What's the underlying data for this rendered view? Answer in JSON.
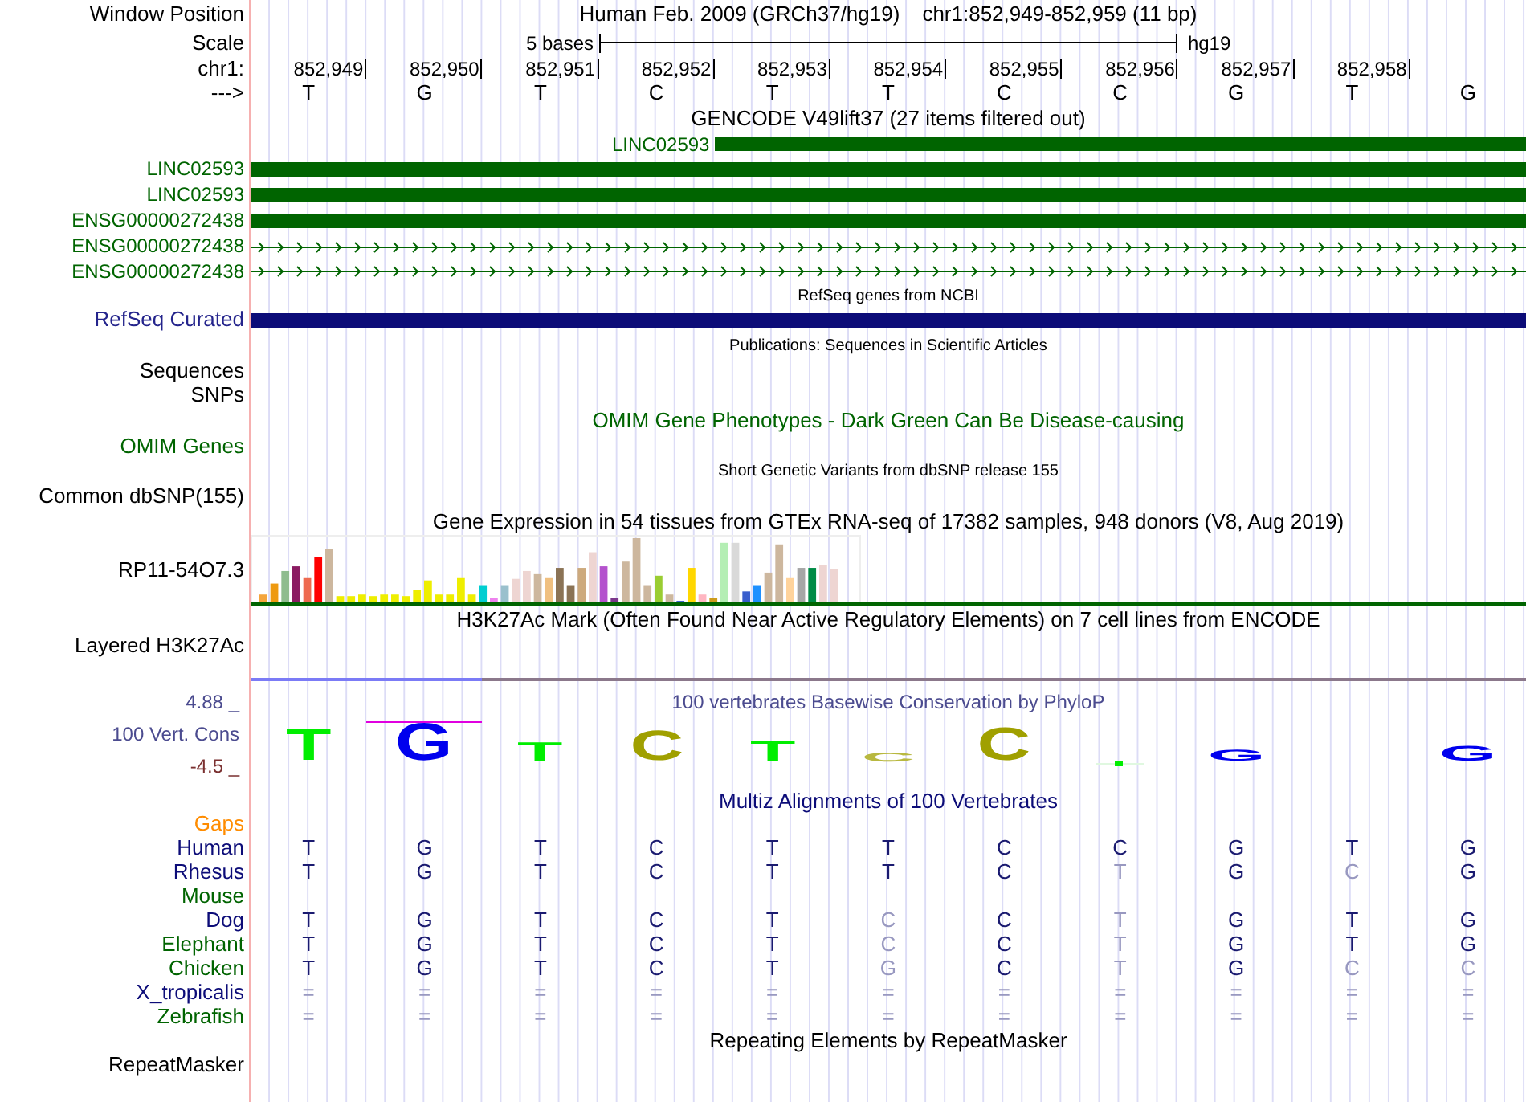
{
  "header": {
    "label": "Window Position",
    "assembly": "Human Feb. 2009 (GRCh37/hg19)",
    "position": "chr1:852,949-852,959 (11 bp)"
  },
  "scale": {
    "label": "Scale",
    "span": "5 bases",
    "assembly": "hg19"
  },
  "ruler": {
    "label": "chr1:",
    "positions": [
      "852,949",
      "852,950",
      "852,951",
      "852,952",
      "852,953",
      "852,954",
      "852,955",
      "852,956",
      "852,957",
      "852,958"
    ]
  },
  "sequence": {
    "label": "--->",
    "bases": [
      "T",
      "G",
      "T",
      "C",
      "T",
      "T",
      "C",
      "C",
      "G",
      "T",
      "G"
    ]
  },
  "gencode": {
    "title": "GENCODE V49lift37 (27 items filtered out)",
    "items": [
      {
        "name": "LINC02593",
        "kind": "partial"
      },
      {
        "name": "LINC02593",
        "kind": "exon"
      },
      {
        "name": "LINC02593",
        "kind": "exon"
      },
      {
        "name": "ENSG00000272438",
        "kind": "exon"
      },
      {
        "name": "ENSG00000272438",
        "kind": "intron"
      },
      {
        "name": "ENSG00000272438",
        "kind": "intron"
      }
    ]
  },
  "refseq": {
    "title": "RefSeq genes from NCBI",
    "label": "RefSeq Curated"
  },
  "publications": {
    "title": "Publications: Sequences in Scientific Articles",
    "labels": [
      "Sequences",
      "SNPs"
    ]
  },
  "omim": {
    "title": "OMIM Gene Phenotypes - Dark Green Can Be Disease-causing",
    "label": "OMIM Genes"
  },
  "dbsnp": {
    "title": "Short Genetic Variants from dbSNP release 155",
    "label": "Common dbSNP(155)"
  },
  "gtex": {
    "title": "Gene Expression in 54 tissues from GTEx RNA-seq of 17382 samples, 948 donors (V8, Aug 2019)",
    "label": "RP11-54O7.3"
  },
  "h3k27ac": {
    "title": "H3K27Ac Mark (Often Found Near Active Regulatory Elements) on 7 cell lines from ENCODE",
    "label": "Layered H3K27Ac"
  },
  "conservation": {
    "title": "100 vertebrates Basewise Conservation by PhyloP",
    "label": "100 Vert. Cons",
    "max": "4.88 _",
    "min": "-4.5 _",
    "logo": [
      {
        "base": "T",
        "color": "#00ee00",
        "marked": false
      },
      {
        "base": "G",
        "color": "#0000ee",
        "marked": true
      },
      {
        "base": "T",
        "color": "#00ee00",
        "marked": false
      },
      {
        "base": "C",
        "color": "#a0a000",
        "marked": false
      },
      {
        "base": "T",
        "color": "#00ee00",
        "marked": false
      },
      {
        "base": "C",
        "color": "#b8b840",
        "marked": false
      },
      {
        "base": "C",
        "color": "#a0a000",
        "marked": false
      },
      {
        "base": "G",
        "color": "#0000ee",
        "marked": false
      },
      {
        "base": "G",
        "color": "#0000ee",
        "marked": false
      }
    ]
  },
  "multiz": {
    "title": "Multiz Alignments of 100 Vertebrates",
    "gaps_label": "Gaps",
    "species": [
      {
        "name": "Human",
        "color": "#0c0c78",
        "bases": [
          {
            "base": "T",
            "faded": false
          },
          {
            "base": "G",
            "faded": false
          },
          {
            "base": "T",
            "faded": false
          },
          {
            "base": "C",
            "faded": false
          },
          {
            "base": "T",
            "faded": false
          },
          {
            "base": "T",
            "faded": false
          },
          {
            "base": "C",
            "faded": false
          },
          {
            "base": "C",
            "faded": false
          },
          {
            "base": "G",
            "faded": false
          },
          {
            "base": "T",
            "faded": false
          },
          {
            "base": "G",
            "faded": false
          }
        ]
      },
      {
        "name": "Rhesus",
        "color": "#0c0c78",
        "bases": [
          {
            "base": "T",
            "faded": false
          },
          {
            "base": "G",
            "faded": false
          },
          {
            "base": "T",
            "faded": false
          },
          {
            "base": "C",
            "faded": false
          },
          {
            "base": "T",
            "faded": false
          },
          {
            "base": "T",
            "faded": false
          },
          {
            "base": "C",
            "faded": false
          },
          {
            "base": "T",
            "faded": true
          },
          {
            "base": "G",
            "faded": false
          },
          {
            "base": "C",
            "faded": true
          },
          {
            "base": "G",
            "faded": false
          }
        ]
      },
      {
        "name": "Mouse",
        "color": "#006400"
      },
      {
        "name": "Dog",
        "color": "#0c0c78",
        "bases": [
          {
            "base": "T",
            "faded": false
          },
          {
            "base": "G",
            "faded": false
          },
          {
            "base": "T",
            "faded": false
          },
          {
            "base": "C",
            "faded": false
          },
          {
            "base": "T",
            "faded": false
          },
          {
            "base": "C",
            "faded": true
          },
          {
            "base": "C",
            "faded": false
          },
          {
            "base": "T",
            "faded": true
          },
          {
            "base": "G",
            "faded": false
          },
          {
            "base": "T",
            "faded": false
          },
          {
            "base": "G",
            "faded": false
          }
        ]
      },
      {
        "name": "Elephant",
        "color": "#006400",
        "bases": [
          {
            "base": "T",
            "faded": false
          },
          {
            "base": "G",
            "faded": false
          },
          {
            "base": "T",
            "faded": false
          },
          {
            "base": "C",
            "faded": false
          },
          {
            "base": "T",
            "faded": false
          },
          {
            "base": "C",
            "faded": true
          },
          {
            "base": "C",
            "faded": false
          },
          {
            "base": "T",
            "faded": true
          },
          {
            "base": "G",
            "faded": false
          },
          {
            "base": "T",
            "faded": false
          },
          {
            "base": "G",
            "faded": false
          }
        ]
      },
      {
        "name": "Chicken",
        "color": "#006400",
        "bases": [
          {
            "base": "T",
            "faded": false
          },
          {
            "base": "G",
            "faded": false
          },
          {
            "base": "T",
            "faded": false
          },
          {
            "base": "C",
            "faded": false
          },
          {
            "base": "T",
            "faded": false
          },
          {
            "base": "G",
            "faded": true
          },
          {
            "base": "C",
            "faded": false
          },
          {
            "base": "T",
            "faded": true
          },
          {
            "base": "G",
            "faded": false
          },
          {
            "base": "C",
            "faded": true
          },
          {
            "base": "C",
            "faded": true
          }
        ]
      },
      {
        "name": "X_tropicalis",
        "color": "#0c0c78",
        "bases": [
          {
            "base": "=",
            "faded": true
          },
          {
            "base": "=",
            "faded": true
          },
          {
            "base": "=",
            "faded": true
          },
          {
            "base": "=",
            "faded": true
          },
          {
            "base": "=",
            "faded": true
          },
          {
            "base": "=",
            "faded": true
          },
          {
            "base": "=",
            "faded": true
          },
          {
            "base": "=",
            "faded": true
          },
          {
            "base": "=",
            "faded": true
          },
          {
            "base": "=",
            "faded": true
          },
          {
            "base": "=",
            "faded": true
          }
        ]
      },
      {
        "name": "Zebrafish",
        "color": "#006400",
        "bases": [
          {
            "base": "=",
            "faded": true
          },
          {
            "base": "=",
            "faded": true
          },
          {
            "base": "=",
            "faded": true
          },
          {
            "base": "=",
            "faded": true
          },
          {
            "base": "=",
            "faded": true
          },
          {
            "base": "=",
            "faded": true
          },
          {
            "base": "=",
            "faded": true
          },
          {
            "base": "=",
            "faded": true
          },
          {
            "base": "=",
            "faded": true
          },
          {
            "base": "=",
            "faded": true
          },
          {
            "base": "=",
            "faded": true
          }
        ]
      }
    ]
  },
  "repeatmasker": {
    "title": "Repeating Elements by RepeatMasker",
    "label": "RepeatMasker"
  }
}
